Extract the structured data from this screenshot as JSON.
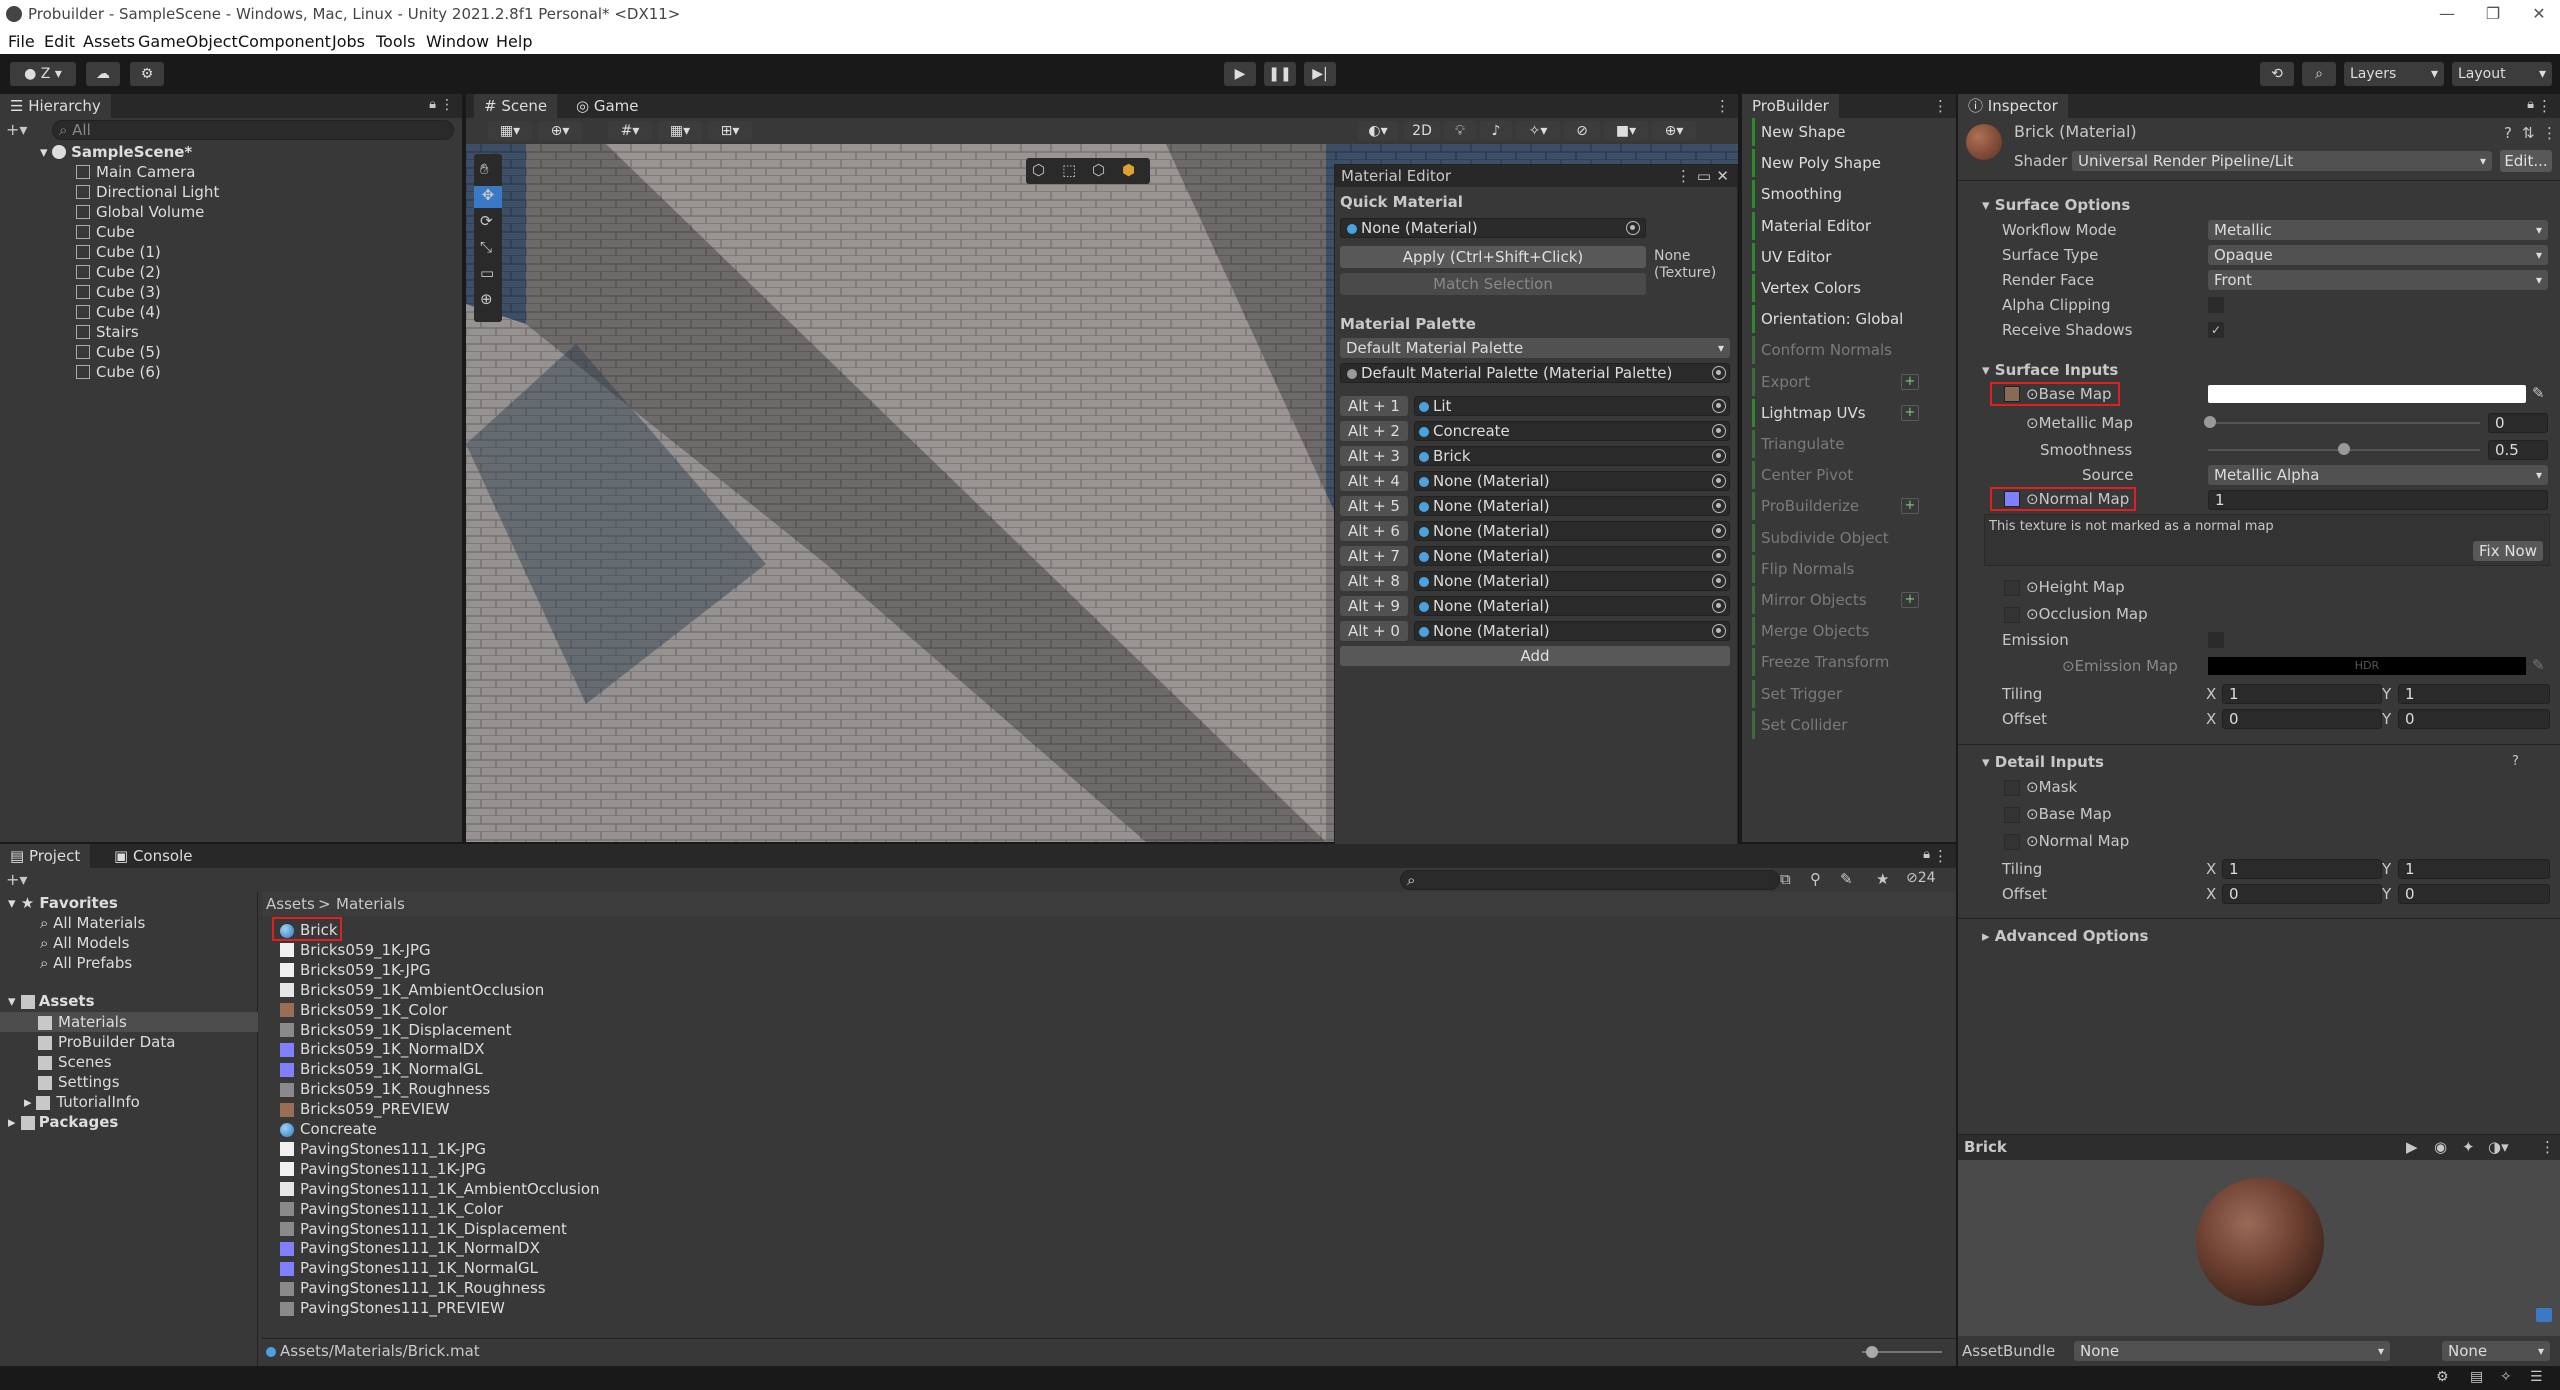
{
  "window": {
    "title": "Probuilder - SampleScene - Windows, Mac, Linux - Unity 2021.2.8f1 Personal* <DX11>"
  },
  "menu": [
    "File",
    "Edit",
    "Assets",
    "GameObject",
    "Component",
    "Jobs",
    "Tools",
    "Window",
    "Help"
  ],
  "toolbar": {
    "layers": "Layers",
    "layout": "Layout",
    "account_initial": "Z"
  },
  "hierarchy": {
    "tab": "Hierarchy",
    "search_placeholder": "All",
    "scene": "SampleScene*",
    "items": [
      "Main Camera",
      "Directional Light",
      "Global Volume",
      "Cube",
      "Cube (1)",
      "Cube (2)",
      "Cube (3)",
      "Cube (4)",
      "Stairs",
      "Cube (5)",
      "Cube (6)"
    ]
  },
  "scene_view": {
    "tab_scene": "Scene",
    "tab_game": "Game",
    "mode_2d": "2D"
  },
  "material_editor": {
    "title": "Material Editor",
    "quick_material": "Quick Material",
    "quick_value": "None (Material)",
    "apply": "Apply (Ctrl+Shift+Click)",
    "none_texture": "None (Texture)",
    "match_selection": "Match Selection",
    "palette_heading": "Material Palette",
    "palette_dropdown": "Default Material Palette",
    "palette_field": "Default Material Palette (Material Palette)",
    "shortcuts": [
      {
        "key": "Alt + 1",
        "mat": "Lit"
      },
      {
        "key": "Alt + 2",
        "mat": "Concreate"
      },
      {
        "key": "Alt + 3",
        "mat": "Brick"
      },
      {
        "key": "Alt + 4",
        "mat": "None (Material)"
      },
      {
        "key": "Alt + 5",
        "mat": "None (Material)"
      },
      {
        "key": "Alt + 6",
        "mat": "None (Material)"
      },
      {
        "key": "Alt + 7",
        "mat": "None (Material)"
      },
      {
        "key": "Alt + 8",
        "mat": "None (Material)"
      },
      {
        "key": "Alt + 9",
        "mat": "None (Material)"
      },
      {
        "key": "Alt + 0",
        "mat": "None (Material)"
      }
    ],
    "add": "Add"
  },
  "probuilder": {
    "tab": "ProBuilder",
    "items": [
      {
        "label": "New Shape",
        "active": true,
        "plus": false
      },
      {
        "label": "New Poly Shape",
        "active": true,
        "plus": false
      },
      {
        "label": "Smoothing",
        "active": true,
        "plus": false
      },
      {
        "label": "Material Editor",
        "active": true,
        "plus": false
      },
      {
        "label": "UV Editor",
        "active": true,
        "plus": false
      },
      {
        "label": "Vertex Colors",
        "active": true,
        "plus": false
      },
      {
        "label": "Orientation: Global",
        "active": true,
        "plus": false
      },
      {
        "label": "Conform Normals",
        "active": false,
        "plus": false
      },
      {
        "label": "Export",
        "active": false,
        "plus": true
      },
      {
        "label": "Lightmap UVs",
        "active": true,
        "plus": true
      },
      {
        "label": "Triangulate",
        "active": false,
        "plus": false
      },
      {
        "label": "Center Pivot",
        "active": false,
        "plus": false
      },
      {
        "label": "ProBuilderize",
        "active": false,
        "plus": true
      },
      {
        "label": "Subdivide Object",
        "active": false,
        "plus": false
      },
      {
        "label": "Flip Normals",
        "active": false,
        "plus": false
      },
      {
        "label": "Mirror Objects",
        "active": false,
        "plus": true
      },
      {
        "label": "Merge Objects",
        "active": false,
        "plus": false
      },
      {
        "label": "Freeze Transform",
        "active": false,
        "plus": false
      },
      {
        "label": "Set Trigger",
        "active": false,
        "plus": false
      },
      {
        "label": "Set Collider",
        "active": false,
        "plus": false
      }
    ]
  },
  "inspector": {
    "tab": "Inspector",
    "title": "Brick (Material)",
    "shader_label": "Shader",
    "shader": "Universal Render Pipeline/Lit",
    "edit": "Edit...",
    "surface_options": "Surface Options",
    "workflow_label": "Workflow Mode",
    "workflow": "Metallic",
    "surface_type_label": "Surface Type",
    "surface_type": "Opaque",
    "render_face_label": "Render Face",
    "render_face": "Front",
    "alpha_clip_label": "Alpha Clipping",
    "receive_shadows_label": "Receive Shadows",
    "surface_inputs": "Surface Inputs",
    "base_map": "Base Map",
    "metallic_map": "Metallic Map",
    "metallic_value": "0",
    "smoothness": "Smoothness",
    "smoothness_value": "0.5",
    "source_label": "Source",
    "source": "Metallic Alpha",
    "normal_map": "Normal Map",
    "normal_value": "1",
    "normal_warning": "This texture is not marked as a normal map",
    "fix_now": "Fix Now",
    "height_map": "Height Map",
    "occlusion_map": "Occlusion Map",
    "emission": "Emission",
    "emission_map": "Emission Map",
    "hdr": "HDR",
    "tiling": "Tiling",
    "offset": "Offset",
    "x": "X",
    "y": "Y",
    "tiling_x": "1",
    "tiling_y": "1",
    "offset_x": "0",
    "offset_y": "0",
    "detail_inputs": "Detail Inputs",
    "mask": "Mask",
    "detail_base_map": "Base Map",
    "detail_normal_map": "Normal Map",
    "d_tiling_x": "1",
    "d_tiling_y": "1",
    "d_offset_x": "0",
    "d_offset_y": "0",
    "advanced": "Advanced Options",
    "preview_title": "Brick",
    "assetbundle_label": "AssetBundle",
    "assetbundle": "None",
    "variant": "None"
  },
  "project": {
    "tab_project": "Project",
    "tab_console": "Console",
    "hidden_count": "24",
    "favorites": "Favorites",
    "fav_items": [
      "All Materials",
      "All Models",
      "All Prefabs"
    ],
    "assets": "Assets",
    "folders": [
      "Materials",
      "ProBuilder Data",
      "Scenes",
      "Settings",
      "TutorialInfo"
    ],
    "packages": "Packages",
    "breadcrumb_root": "Assets",
    "breadcrumb_leaf": "Materials",
    "files": [
      {
        "name": "Brick",
        "icon": "material"
      },
      {
        "name": "Bricks059_1K-JPG",
        "icon": "file"
      },
      {
        "name": "Bricks059_1K-JPG",
        "icon": "file"
      },
      {
        "name": "Bricks059_1K_AmbientOcclusion",
        "icon": "tex-light"
      },
      {
        "name": "Bricks059_1K_Color",
        "icon": "tex-brown"
      },
      {
        "name": "Bricks059_1K_Displacement",
        "icon": "tex-gray"
      },
      {
        "name": "Bricks059_1K_NormalDX",
        "icon": "tex-normal"
      },
      {
        "name": "Bricks059_1K_NormalGL",
        "icon": "tex-normal"
      },
      {
        "name": "Bricks059_1K_Roughness",
        "icon": "tex-gray"
      },
      {
        "name": "Bricks059_PREVIEW",
        "icon": "tex-brown"
      },
      {
        "name": "Concreate",
        "icon": "material"
      },
      {
        "name": "PavingStones111_1K-JPG",
        "icon": "file"
      },
      {
        "name": "PavingStones111_1K-JPG",
        "icon": "file"
      },
      {
        "name": "PavingStones111_1K_AmbientOcclusion",
        "icon": "tex-light"
      },
      {
        "name": "PavingStones111_1K_Color",
        "icon": "tex-gray"
      },
      {
        "name": "PavingStones111_1K_Displacement",
        "icon": "tex-gray"
      },
      {
        "name": "PavingStones111_1K_NormalDX",
        "icon": "tex-normal"
      },
      {
        "name": "PavingStones111_1K_NormalGL",
        "icon": "tex-normal"
      },
      {
        "name": "PavingStones111_1K_Roughness",
        "icon": "tex-gray"
      },
      {
        "name": "PavingStones111_PREVIEW",
        "icon": "tex-gray"
      }
    ],
    "status_path": "Assets/Materials/Brick.mat"
  },
  "colors": {
    "accent": "#3a79c6",
    "highlight_box": "#e02020",
    "probuilder_green": "#2c8a2c"
  }
}
